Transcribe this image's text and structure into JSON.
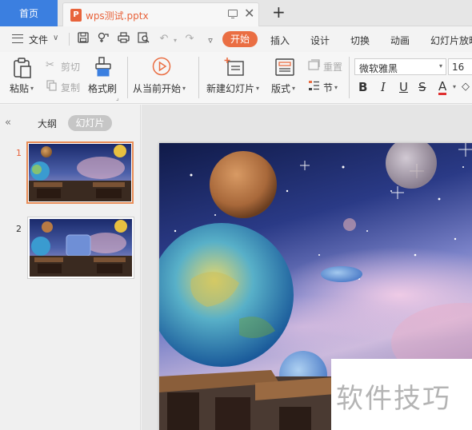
{
  "tabs": {
    "home": "首页",
    "document": "wps测试.pptx",
    "document_icon": "P",
    "new_tab": "+"
  },
  "menu": {
    "file": "文件",
    "ribbon_tabs": [
      "开始",
      "插入",
      "设计",
      "切换",
      "动画",
      "幻灯片放映"
    ]
  },
  "ribbon": {
    "paste": "粘贴",
    "cut": "剪切",
    "copy": "复制",
    "format_painter": "格式刷",
    "from_current": "从当前开始",
    "new_slide": "新建幻灯片",
    "layout": "版式",
    "reset": "重置",
    "section": "节",
    "font_name": "微软雅黑",
    "font_size": "16",
    "bold": "B",
    "italic": "I",
    "underline": "U",
    "strikethrough": "S",
    "font_color": "A"
  },
  "left_pane": {
    "outline_tab": "大纲",
    "slides_tab": "幻灯片",
    "slides": [
      {
        "number": "1",
        "selected": true
      },
      {
        "number": "2",
        "selected": false
      }
    ]
  },
  "watermark": "软件技巧",
  "colors": {
    "home_tab": "#3b7fe0",
    "accent_orange": "#ea6e43",
    "selected_thumb_border": "#e88d58",
    "font_color_bar": "#e03030"
  }
}
